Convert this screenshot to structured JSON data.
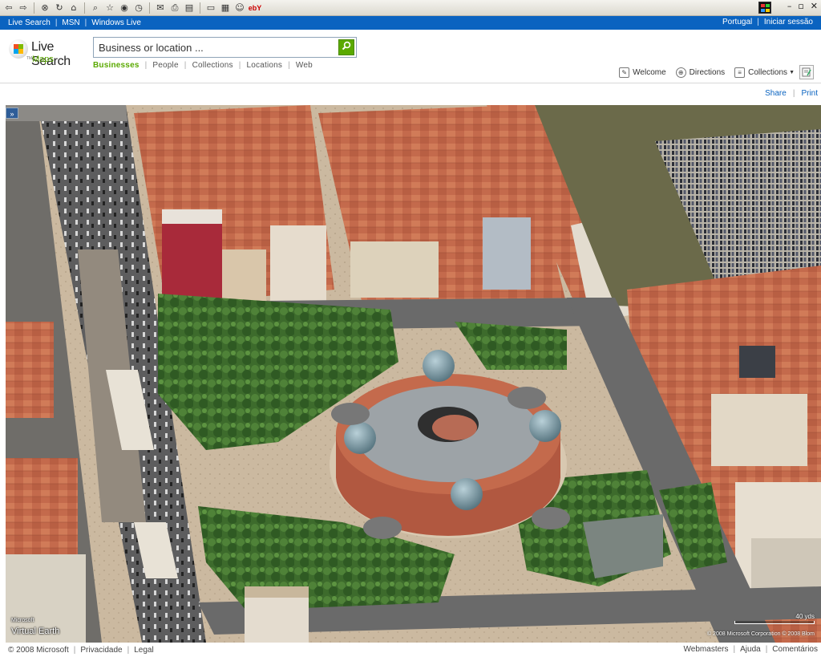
{
  "topbar": {
    "links": [
      "Live Search",
      "MSN",
      "Windows Live"
    ],
    "right_links": [
      "Portugal",
      "Iniciar sessão"
    ]
  },
  "brand": {
    "title": "Live Search",
    "subtitle": "Maps",
    "tm": "TM"
  },
  "search": {
    "placeholder": "Business or location ...",
    "button_icon": "search-icon"
  },
  "search_tabs": [
    {
      "label": "Businesses",
      "active": true
    },
    {
      "label": "People"
    },
    {
      "label": "Collections"
    },
    {
      "label": "Locations"
    },
    {
      "label": "Web"
    }
  ],
  "actions": {
    "welcome": "Welcome",
    "directions": "Directions",
    "collections": "Collections"
  },
  "map_tools": {
    "share": "Share",
    "print": "Print"
  },
  "map": {
    "logo_top": "Microsoft",
    "logo_bottom": "Virtual Earth",
    "scale_label": "40 yds",
    "copyright": "© 2008 Microsoft Corporation   © 2008 Blom"
  },
  "footer": {
    "left": [
      "© 2008 Microsoft",
      "Privacidade",
      "Legal"
    ],
    "right": [
      "Webmasters",
      "Ajuda",
      "Comentários"
    ]
  },
  "colors": {
    "brand_blue": "#0a63c0",
    "brand_green": "#5aa900"
  }
}
